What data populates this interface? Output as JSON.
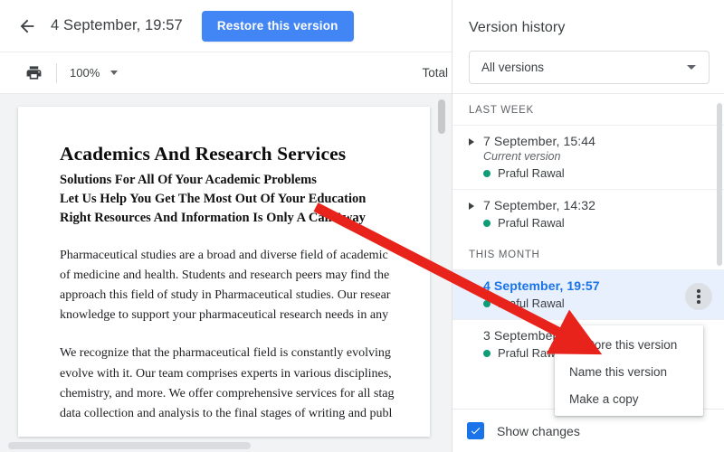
{
  "header": {
    "back_icon": "back-arrow-icon",
    "title": "4 September, 19:57",
    "restore_button": "Restore this version"
  },
  "toolbar": {
    "print_icon": "print-icon",
    "zoom_value": "100%",
    "zoom_caret_icon": "chevron-down-icon",
    "right_label": "Total"
  },
  "document": {
    "heading": "Academics And Research Services",
    "subheadings": [
      "Solutions For All Of Your Academic Problems",
      "Let Us Help You Get The Most Out Of Your Education",
      "Right Resources And Information Is Only A Call Away"
    ],
    "paragraphs": [
      [
        "Pharmaceutical studies are a broad and diverse field of academic",
        "of medicine and health. Students and research peers may find the",
        "approach this field of study in Pharmaceutical studies. Our resear",
        "knowledge to support your pharmaceutical research needs in any"
      ],
      [
        "We recognize that the pharmaceutical field is constantly evolving",
        "evolve with it. Our team comprises experts in various disciplines,",
        "chemistry, and more. We offer comprehensive services for all stag",
        "data collection and analysis to the final stages of writing and publ"
      ]
    ]
  },
  "version_history": {
    "title": "Version history",
    "filter": {
      "value": "All versions",
      "caret_icon": "chevron-down-icon"
    },
    "groups": [
      {
        "label": "LAST WEEK",
        "items": [
          {
            "date": "7 September, 15:44",
            "current_label": "Current version",
            "author": "Praful Rawal",
            "selected": false,
            "dot_color": "#0f9d77"
          },
          {
            "date": "7 September, 14:32",
            "current_label": "",
            "author": "Praful Rawal",
            "selected": false,
            "dot_color": "#0f9d77"
          }
        ]
      },
      {
        "label": "THIS MONTH",
        "items": [
          {
            "date": "4 September, 19:57",
            "current_label": "",
            "author": "Praful Rawal",
            "selected": true,
            "dot_color": "#0f9d77"
          },
          {
            "date": "3 September",
            "current_label": "",
            "author": "Praful Rawal",
            "selected": false,
            "dot_color": "#0f9d77"
          }
        ]
      }
    ],
    "footer": {
      "show_changes_label": "Show changes",
      "show_changes_checked": true,
      "check_icon": "checkmark-icon"
    }
  },
  "context_menu": {
    "items": [
      "Restore this version",
      "Name this version",
      "Make a copy"
    ]
  },
  "annotation": {
    "arrow_color": "#e8231b",
    "arrow_name": "red-pointer-arrow"
  },
  "colors": {
    "accent_blue": "#4285f4",
    "selected_row": "#e8f0fe",
    "selected_text": "#1a73e8",
    "author_dot": "#0f9d77"
  }
}
